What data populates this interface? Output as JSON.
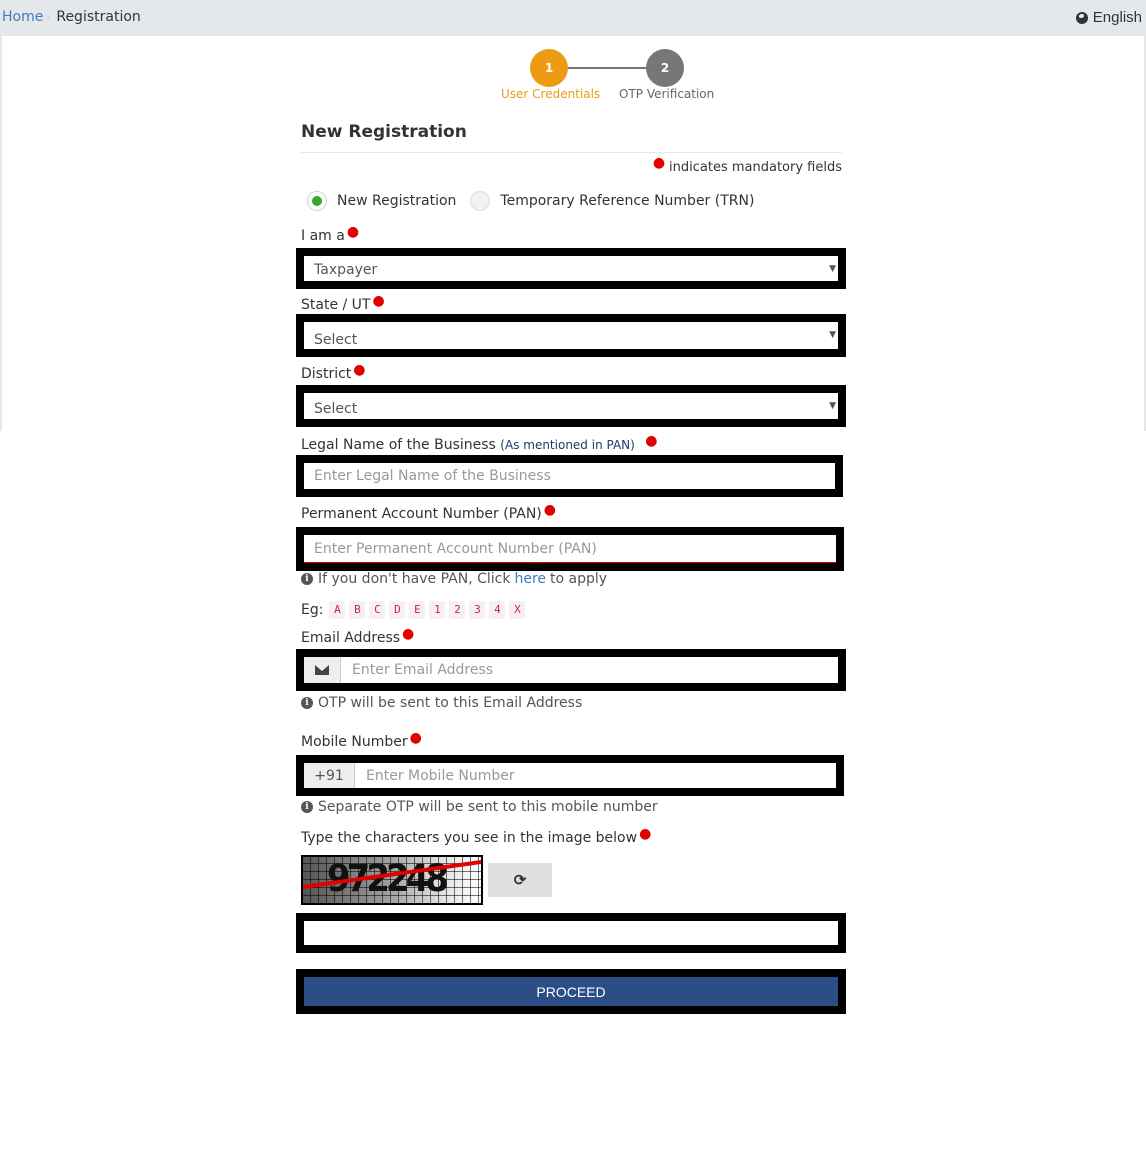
{
  "breadcrumb": {
    "home": "Home",
    "separator": "›",
    "current": "Registration"
  },
  "language": {
    "icon": "globe-icon",
    "label": "English"
  },
  "stepper": {
    "steps": [
      {
        "number": "1",
        "label": "User Credentials",
        "state": "active",
        "color": "#ec9b13"
      },
      {
        "number": "2",
        "label": "OTP Verification",
        "state": "pending",
        "color": "#777777"
      }
    ]
  },
  "form": {
    "title": "New Registration",
    "mandatory_note": "indicates mandatory fields",
    "registration_type": {
      "options": [
        {
          "label": "New Registration",
          "checked": true
        },
        {
          "label": "Temporary Reference Number (TRN)",
          "checked": false
        }
      ]
    },
    "i_am_a": {
      "label": "I am a",
      "value": "Taxpayer"
    },
    "state": {
      "label": "State / UT",
      "value": "Select"
    },
    "district": {
      "label": "District",
      "value": "Select"
    },
    "legal_name": {
      "label": "Legal Name of the Business",
      "sub_label": "(As mentioned in PAN)",
      "placeholder": "Enter Legal Name of the Business",
      "value": ""
    },
    "pan": {
      "label": "Permanent Account Number (PAN)",
      "placeholder": "Enter Permanent Account Number (PAN)",
      "value": "",
      "help_prefix": "If you don't have PAN, Click",
      "help_link": "here",
      "help_suffix": "to apply",
      "example_label": "Eg:",
      "example_chars": [
        "A",
        "B",
        "C",
        "D",
        "E",
        "1",
        "2",
        "3",
        "4",
        "X"
      ]
    },
    "email": {
      "label": "Email Address",
      "icon": "envelope-icon",
      "placeholder": "Enter Email Address",
      "value": "",
      "help": "OTP will be sent to this Email Address"
    },
    "mobile": {
      "label": "Mobile Number",
      "prefix": "+91",
      "placeholder": "Enter Mobile Number",
      "value": "",
      "help": "Separate OTP will be sent to this mobile number"
    },
    "captcha": {
      "label": "Type the characters you see in the image below",
      "image_text": "972248",
      "refresh_icon": "refresh-icon",
      "value": ""
    },
    "proceed_label": "PROCEED"
  },
  "colors": {
    "accent": "#ec9b13",
    "primary_button": "#2c4e86",
    "required": "#e00000",
    "link": "#3d7bbf",
    "radio_checked": "#36a82b"
  }
}
